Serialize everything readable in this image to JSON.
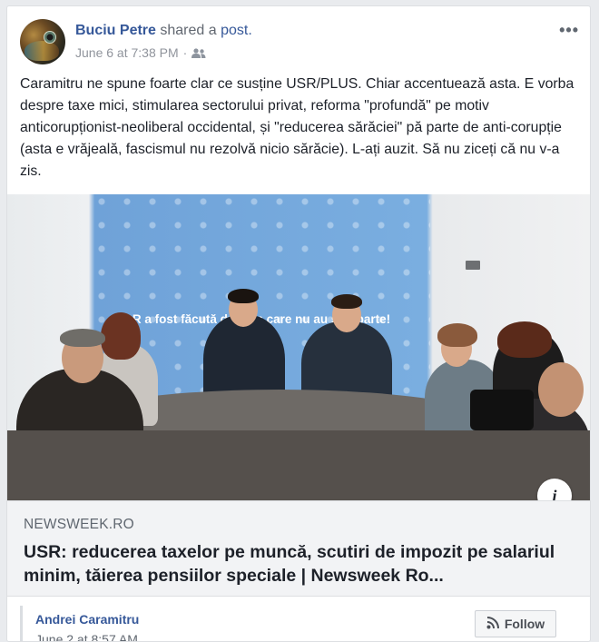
{
  "post": {
    "author": "Buciu Petre",
    "action": "shared a",
    "object": "post.",
    "timestamp": "June 6 at 7:38 PM",
    "separator": "·",
    "audience_icon": "friends-icon",
    "more_label": "•••",
    "text": "Caramitru ne spune foarte clar ce susține USR/PLUS. Chiar accentuează asta. E vorba despre taxe mici, stimularea sectorului privat, reforma \"profundă\" pe motiv anticorupționist-neoliberal occidental, și \"reducerea sărăciei\" pă parte de anti-corupție (asta e vrăjeală, fascismul nu rezolvă nicio sărăcie). L-ați auzit. Să nu ziceți că nu v-a zis."
  },
  "link": {
    "banner_text": "R   a fost făcută de oam   care nu au sti   oparte!",
    "info_label": "i",
    "domain": "NEWSWEEK.RO",
    "title": "USR: reducerea taxelor pe muncă, scutiri de impozit pe salariul minim, tăierea pensiilor speciale | Newsweek Ro..."
  },
  "shared_source": {
    "name": "Andrei Caramitru",
    "date": "June 2 at 8:57 AM",
    "follow_label": "Follow",
    "follow_icon": "rss-icon"
  },
  "colors": {
    "link_blue": "#365899",
    "meta_gray": "#90949c",
    "banner_blue": "#7aaee0"
  }
}
